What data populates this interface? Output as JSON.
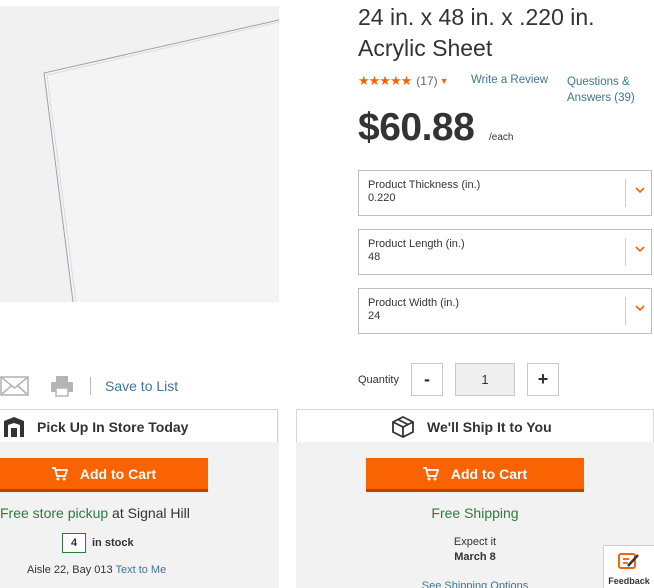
{
  "product": {
    "title": "24 in. x 48 in. x .220 in. Acrylic Sheet",
    "stars": "★★★★★",
    "review_count": "(17)",
    "write_review": "Write a Review",
    "qa_link": "Questions & Answers (39)",
    "price": "$60.88",
    "price_unit": "/each",
    "rating_value": 4.5
  },
  "options": [
    {
      "label": "Product Thickness (in.)",
      "value": "0.220"
    },
    {
      "label": "Product Length (in.)",
      "value": "48"
    },
    {
      "label": "Product Width (in.)",
      "value": "24"
    }
  ],
  "share": {
    "save_to_list": "Save to List",
    "icons": [
      "mail-icon",
      "print-icon"
    ]
  },
  "quantity": {
    "label": "Quantity",
    "minus": "-",
    "value": "1",
    "plus": "+"
  },
  "pickup": {
    "title": "Pick Up In Store Today",
    "add_to_cart": "Add to Cart",
    "free_pickup_link": "Free store pickup",
    "pickup_suffix": " at Signal Hill",
    "stock_count": "4",
    "stock_label": "in stock",
    "aisle": "Aisle 22, Bay 013 ",
    "text_to_me": "Text to Me"
  },
  "ship": {
    "title": "We'll Ship It to You",
    "add_to_cart": "Add to Cart",
    "free_shipping": "Free Shipping",
    "expect": "Expect it",
    "date": "March 8",
    "options_link": "See Shipping Options"
  },
  "feedback": {
    "label": "Feedback"
  },
  "colors": {
    "accent": "#f96302",
    "link": "#3e7697",
    "green": "#2e7b39",
    "panel_bg": "#f2f2f2"
  }
}
